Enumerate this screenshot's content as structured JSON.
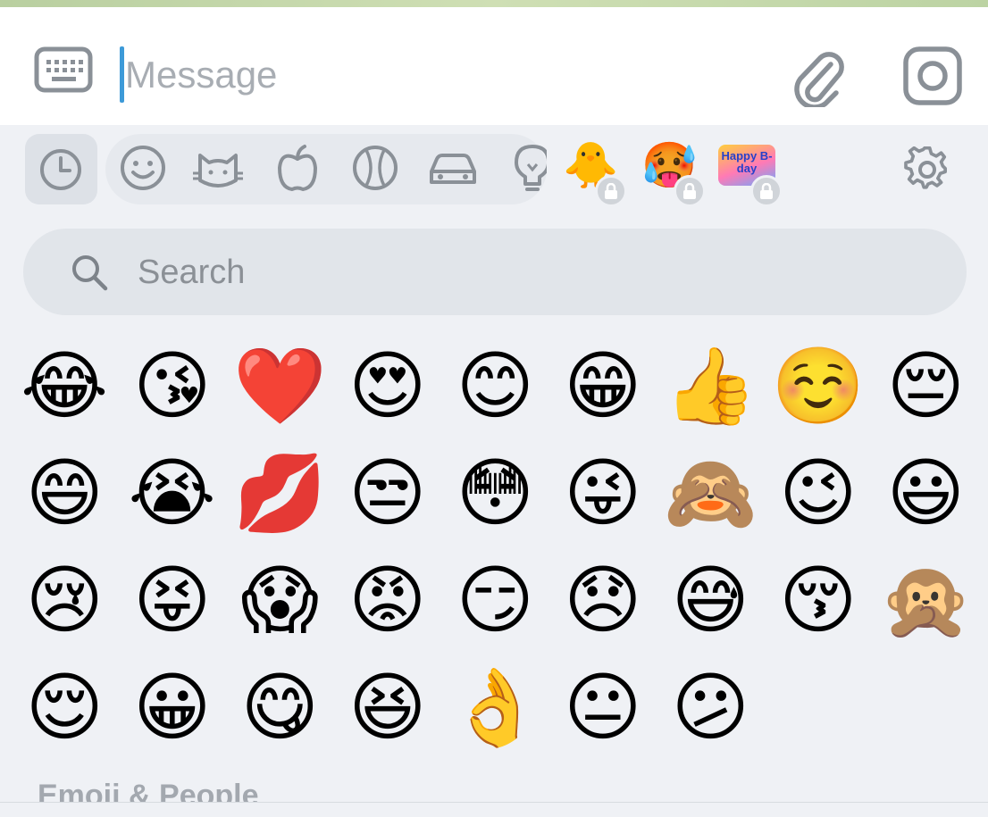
{
  "composer": {
    "placeholder": "Message",
    "keyboard_icon": "keyboard-icon",
    "attach_icon": "paperclip-icon",
    "camera_icon": "camera-icon"
  },
  "tabs": {
    "recent": "clock-icon",
    "categories": [
      "smiley-icon",
      "cat-icon",
      "apple-icon",
      "ball-icon",
      "car-icon",
      "lightbulb-icon"
    ],
    "packs": [
      {
        "emoji": "🐥",
        "locked": true
      },
      {
        "emoji": "🥵",
        "locked": true
      },
      {
        "text": "Happy B-day",
        "locked": true
      }
    ],
    "settings": "gear-icon"
  },
  "search": {
    "placeholder": "Search"
  },
  "emoji_grid": [
    [
      "😂",
      "😘",
      "❤️",
      "😍",
      "😊",
      "😁",
      "👍",
      "☺️",
      "😔"
    ],
    [
      "😄",
      "😭",
      "💋",
      "😒",
      "😳",
      "😜",
      "🙈",
      "😉",
      "😃"
    ],
    [
      "😢",
      "😝",
      "😱",
      "😡",
      "😏",
      "😞",
      "😅",
      "😚",
      "🙊"
    ],
    [
      "😌",
      "😀",
      "😋",
      "😆",
      "👌",
      "😐",
      "😕"
    ]
  ],
  "section": {
    "title": "Emoji & People"
  },
  "colors": {
    "accent": "#3d9ad8",
    "icon": "#8a9097",
    "panel": "#eff1f5"
  }
}
